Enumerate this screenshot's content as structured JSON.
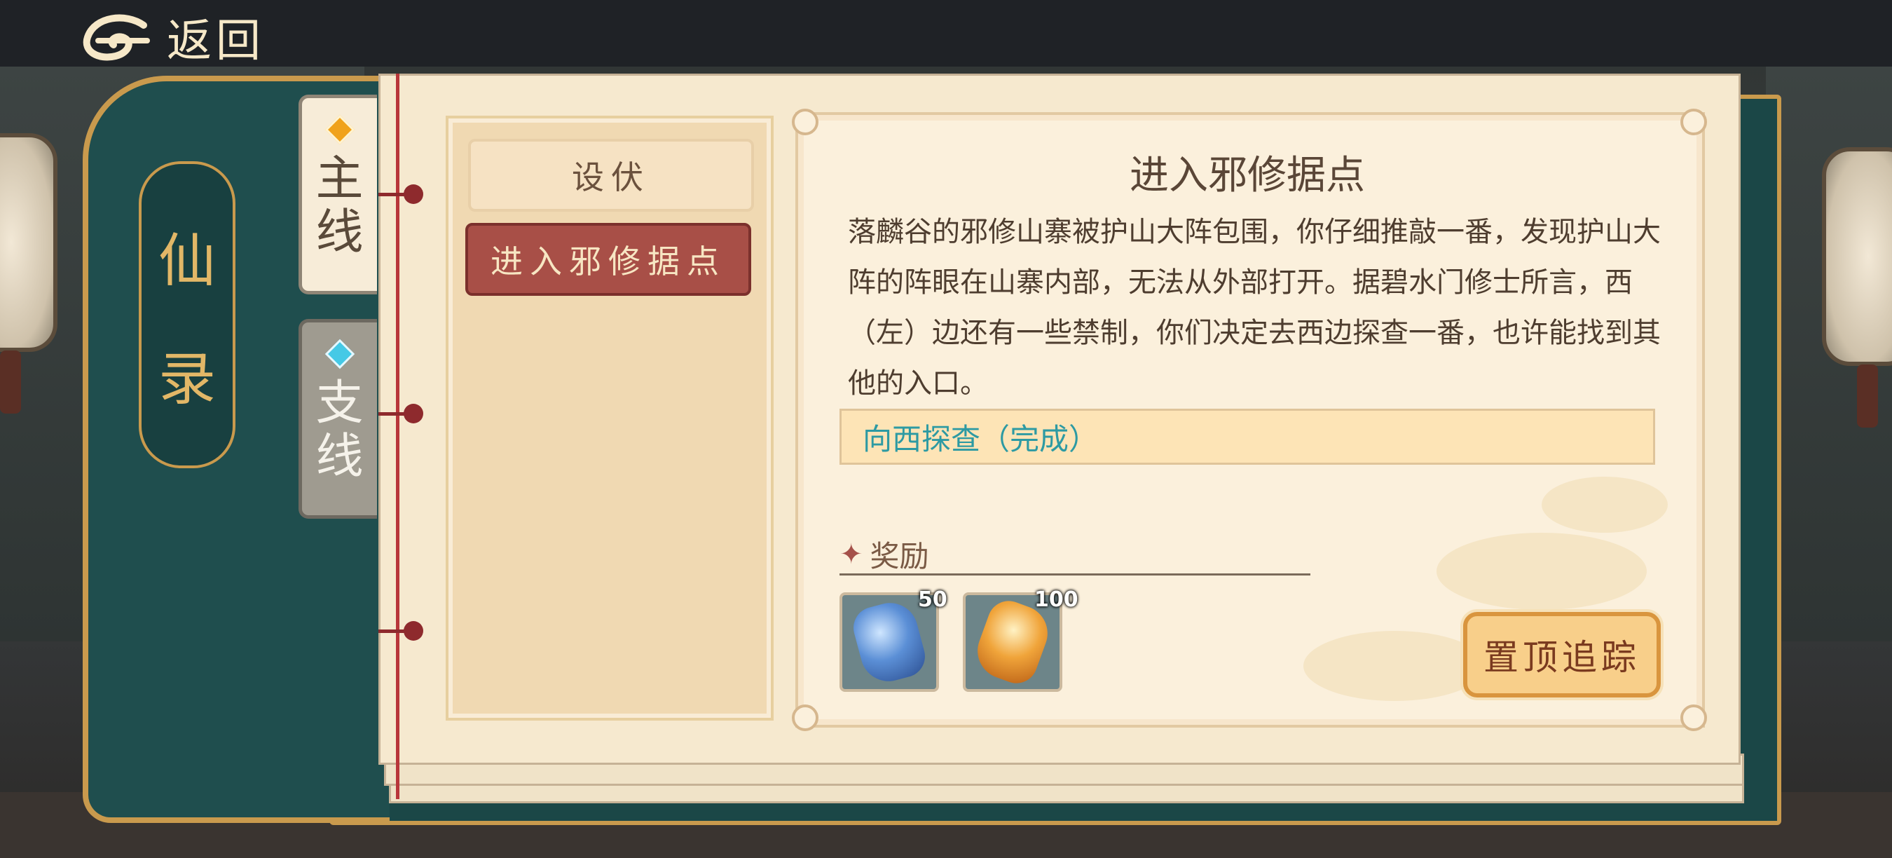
{
  "header": {
    "back_label": "返回"
  },
  "book": {
    "title_chars": [
      "仙",
      "录"
    ]
  },
  "tabs": [
    {
      "chars": [
        "主",
        "线"
      ],
      "active": true,
      "diamond_color": "#f0a21b"
    },
    {
      "chars": [
        "支",
        "线"
      ],
      "active": false,
      "diamond_color": "#45c9e6"
    }
  ],
  "quest_list": [
    {
      "label": "设伏",
      "selected": false
    },
    {
      "label": "进入邪修据点",
      "selected": true
    }
  ],
  "detail": {
    "title": "进入邪修据点",
    "description": "落麟谷的邪修山寨被护山大阵包围，你仔细推敲一番，发现护山大阵的阵眼在山寨内部，无法从外部打开。据碧水门修士所言，西（左）边还有一些禁制，你们决定去西边探查一番，也许能找到其他的入口。",
    "objective": "向西探查（完成）"
  },
  "rewards": {
    "label": "奖励",
    "items": [
      {
        "icon": "blue-crystal-icon",
        "count": "50"
      },
      {
        "icon": "amber-crystal-icon",
        "count": "100"
      }
    ]
  },
  "track_button": {
    "label": "置顶追踪"
  },
  "colors": {
    "accent_red": "#a84f47",
    "objective_teal": "#2d9aa3",
    "book_teal": "#1f4e4e",
    "gold": "#c99a4d"
  }
}
